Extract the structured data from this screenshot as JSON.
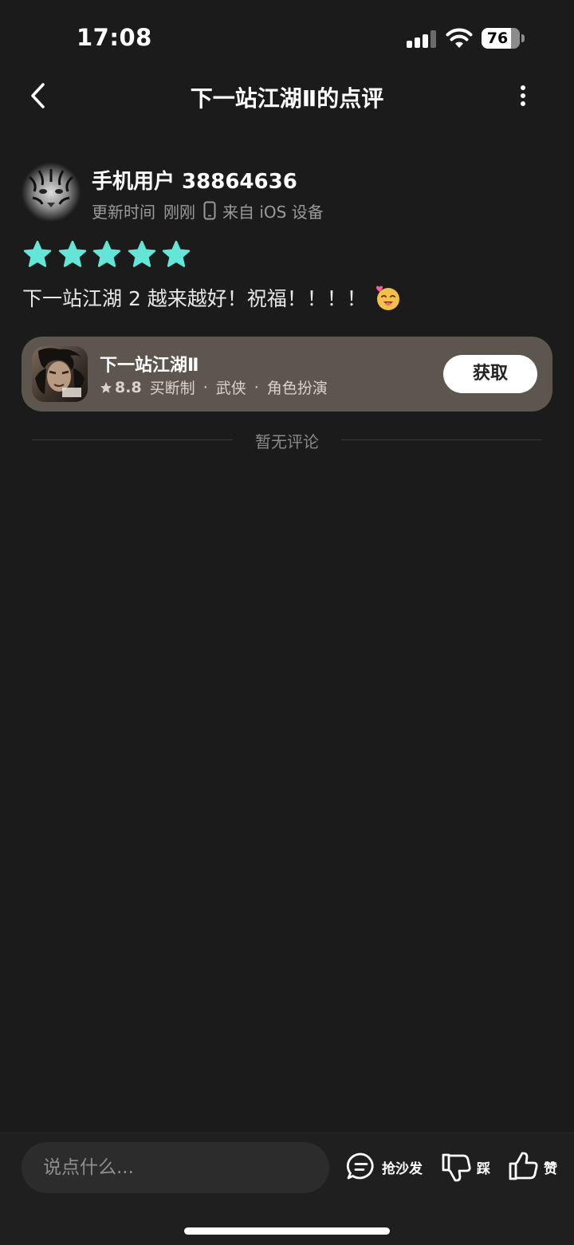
{
  "status_bar": {
    "time": "17:08",
    "battery": "76"
  },
  "nav": {
    "title": "下一站江湖Ⅱ的点评",
    "back_icon": "chevron-left-icon",
    "more_icon": "more-vertical-icon"
  },
  "review": {
    "user_name": "手机用户 38864636",
    "update_label": "更新时间",
    "update_time": "刚刚",
    "device_text": "来自 iOS 设备",
    "stars": 5,
    "star_color": "#63e6d8",
    "text": "下一站江湖 2 越来越好！祝福！！！！"
  },
  "game_card": {
    "title": "下一站江湖Ⅱ",
    "rating": "8.8",
    "tags": [
      "买断制",
      "武侠",
      "角色扮演"
    ],
    "get_label": "获取",
    "card_color": "#5c564f"
  },
  "comments": {
    "empty_text": "暂无评论"
  },
  "bottom_bar": {
    "input_placeholder": "说点什么...",
    "sofa_label": "抢沙发",
    "dislike_label": "踩",
    "like_label": "赞"
  }
}
